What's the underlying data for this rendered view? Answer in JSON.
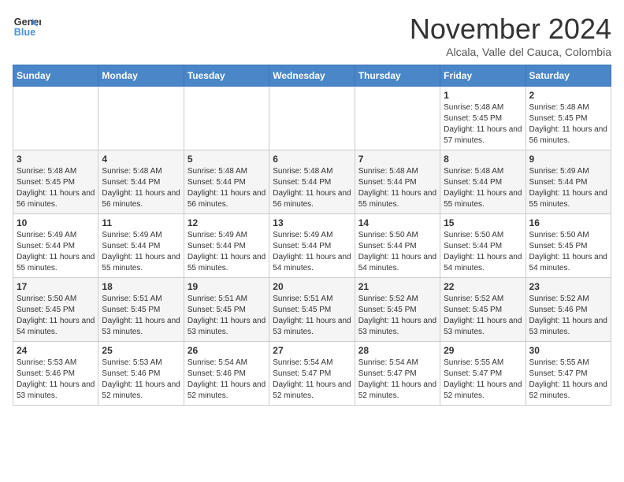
{
  "header": {
    "logo_line1": "General",
    "logo_line2": "Blue",
    "month": "November 2024",
    "location": "Alcala, Valle del Cauca, Colombia"
  },
  "days_of_week": [
    "Sunday",
    "Monday",
    "Tuesday",
    "Wednesday",
    "Thursday",
    "Friday",
    "Saturday"
  ],
  "weeks": [
    [
      {
        "day": "",
        "info": ""
      },
      {
        "day": "",
        "info": ""
      },
      {
        "day": "",
        "info": ""
      },
      {
        "day": "",
        "info": ""
      },
      {
        "day": "",
        "info": ""
      },
      {
        "day": "1",
        "info": "Sunrise: 5:48 AM\nSunset: 5:45 PM\nDaylight: 11 hours and 57 minutes."
      },
      {
        "day": "2",
        "info": "Sunrise: 5:48 AM\nSunset: 5:45 PM\nDaylight: 11 hours and 56 minutes."
      }
    ],
    [
      {
        "day": "3",
        "info": "Sunrise: 5:48 AM\nSunset: 5:45 PM\nDaylight: 11 hours and 56 minutes."
      },
      {
        "day": "4",
        "info": "Sunrise: 5:48 AM\nSunset: 5:44 PM\nDaylight: 11 hours and 56 minutes."
      },
      {
        "day": "5",
        "info": "Sunrise: 5:48 AM\nSunset: 5:44 PM\nDaylight: 11 hours and 56 minutes."
      },
      {
        "day": "6",
        "info": "Sunrise: 5:48 AM\nSunset: 5:44 PM\nDaylight: 11 hours and 56 minutes."
      },
      {
        "day": "7",
        "info": "Sunrise: 5:48 AM\nSunset: 5:44 PM\nDaylight: 11 hours and 55 minutes."
      },
      {
        "day": "8",
        "info": "Sunrise: 5:48 AM\nSunset: 5:44 PM\nDaylight: 11 hours and 55 minutes."
      },
      {
        "day": "9",
        "info": "Sunrise: 5:49 AM\nSunset: 5:44 PM\nDaylight: 11 hours and 55 minutes."
      }
    ],
    [
      {
        "day": "10",
        "info": "Sunrise: 5:49 AM\nSunset: 5:44 PM\nDaylight: 11 hours and 55 minutes."
      },
      {
        "day": "11",
        "info": "Sunrise: 5:49 AM\nSunset: 5:44 PM\nDaylight: 11 hours and 55 minutes."
      },
      {
        "day": "12",
        "info": "Sunrise: 5:49 AM\nSunset: 5:44 PM\nDaylight: 11 hours and 55 minutes."
      },
      {
        "day": "13",
        "info": "Sunrise: 5:49 AM\nSunset: 5:44 PM\nDaylight: 11 hours and 54 minutes."
      },
      {
        "day": "14",
        "info": "Sunrise: 5:50 AM\nSunset: 5:44 PM\nDaylight: 11 hours and 54 minutes."
      },
      {
        "day": "15",
        "info": "Sunrise: 5:50 AM\nSunset: 5:44 PM\nDaylight: 11 hours and 54 minutes."
      },
      {
        "day": "16",
        "info": "Sunrise: 5:50 AM\nSunset: 5:45 PM\nDaylight: 11 hours and 54 minutes."
      }
    ],
    [
      {
        "day": "17",
        "info": "Sunrise: 5:50 AM\nSunset: 5:45 PM\nDaylight: 11 hours and 54 minutes."
      },
      {
        "day": "18",
        "info": "Sunrise: 5:51 AM\nSunset: 5:45 PM\nDaylight: 11 hours and 53 minutes."
      },
      {
        "day": "19",
        "info": "Sunrise: 5:51 AM\nSunset: 5:45 PM\nDaylight: 11 hours and 53 minutes."
      },
      {
        "day": "20",
        "info": "Sunrise: 5:51 AM\nSunset: 5:45 PM\nDaylight: 11 hours and 53 minutes."
      },
      {
        "day": "21",
        "info": "Sunrise: 5:52 AM\nSunset: 5:45 PM\nDaylight: 11 hours and 53 minutes."
      },
      {
        "day": "22",
        "info": "Sunrise: 5:52 AM\nSunset: 5:45 PM\nDaylight: 11 hours and 53 minutes."
      },
      {
        "day": "23",
        "info": "Sunrise: 5:52 AM\nSunset: 5:46 PM\nDaylight: 11 hours and 53 minutes."
      }
    ],
    [
      {
        "day": "24",
        "info": "Sunrise: 5:53 AM\nSunset: 5:46 PM\nDaylight: 11 hours and 53 minutes."
      },
      {
        "day": "25",
        "info": "Sunrise: 5:53 AM\nSunset: 5:46 PM\nDaylight: 11 hours and 52 minutes."
      },
      {
        "day": "26",
        "info": "Sunrise: 5:54 AM\nSunset: 5:46 PM\nDaylight: 11 hours and 52 minutes."
      },
      {
        "day": "27",
        "info": "Sunrise: 5:54 AM\nSunset: 5:47 PM\nDaylight: 11 hours and 52 minutes."
      },
      {
        "day": "28",
        "info": "Sunrise: 5:54 AM\nSunset: 5:47 PM\nDaylight: 11 hours and 52 minutes."
      },
      {
        "day": "29",
        "info": "Sunrise: 5:55 AM\nSunset: 5:47 PM\nDaylight: 11 hours and 52 minutes."
      },
      {
        "day": "30",
        "info": "Sunrise: 5:55 AM\nSunset: 5:47 PM\nDaylight: 11 hours and 52 minutes."
      }
    ]
  ]
}
